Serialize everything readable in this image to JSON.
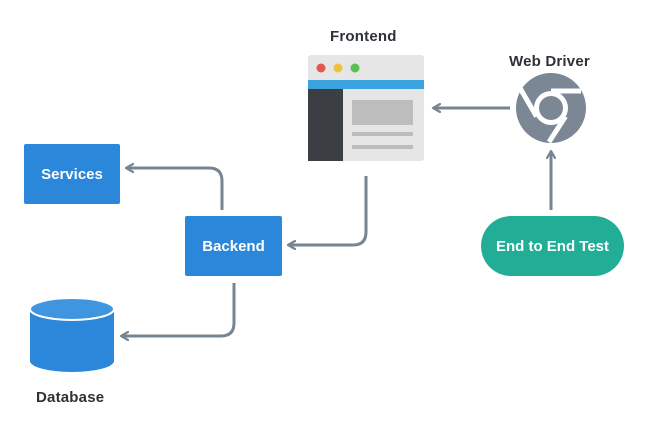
{
  "nodes": {
    "frontend": {
      "label": "Frontend"
    },
    "web_driver": {
      "label": "Web Driver"
    },
    "services": {
      "label": "Services"
    },
    "backend": {
      "label": "Backend"
    },
    "database": {
      "label": "Database"
    },
    "e2e_test": {
      "label": "End to End Test"
    }
  },
  "colors": {
    "node_blue": "#2b87d9",
    "test_green": "#22ad97",
    "arrow": "#778592",
    "chrome_gray": "#7b8794",
    "browser_chrome": "#e6e6e6",
    "browser_accent": "#3aa3dd",
    "browser_sidebar": "#3b3e42"
  }
}
